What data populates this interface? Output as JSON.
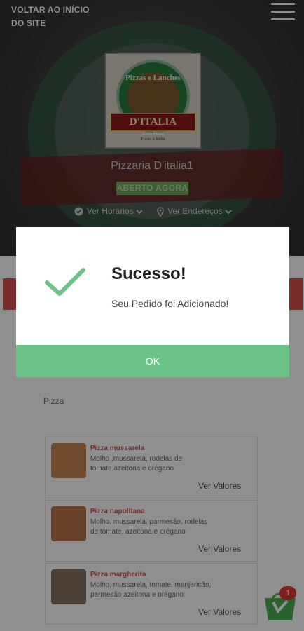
{
  "header": {
    "back_link": "VOLTAR AO INÍCIO DO SITE",
    "menu_icon": "hamburger-menu-icon"
  },
  "store": {
    "logo": {
      "top_text": "Pizzas e Lanches",
      "ribbon_text": "D'ITALIA",
      "sub_text_1": "Bom Pizza",
      "sub_text_2": "Forno à lenha"
    },
    "name": "Pizzaria D'italia1",
    "status": "ABERTO AGORA",
    "hours_label": "Ver Horários",
    "address_label": "Ver Endereços"
  },
  "modal": {
    "icon": "checkmark-icon",
    "title": "Sucesso!",
    "message": "Seu Pedido foi Adicionado!",
    "ok_label": "OK"
  },
  "menu": {
    "category": "Pizza",
    "products": [
      {
        "name": "Pizza mussarela",
        "description": "Molho ,mussarela, rodelas de tomate,azeitona e orégano",
        "action": "Ver Valores"
      },
      {
        "name": "Pizza napolitana",
        "description": "Molho, mussarela, parmesão, rodelas de tomate, azeitona e orégano",
        "action": "Ver Valores"
      },
      {
        "name": "Pizza margherita",
        "description": "Molho, mussarela, tomate, manjericão, parmesão azeitona e orégano",
        "action": "Ver Valores"
      }
    ]
  },
  "cart": {
    "count": "1",
    "icon": "shopping-bag-icon"
  },
  "colors": {
    "accent_green": "#6cc387",
    "accent_red": "#d9534f",
    "status_green": "#6fa85b"
  }
}
